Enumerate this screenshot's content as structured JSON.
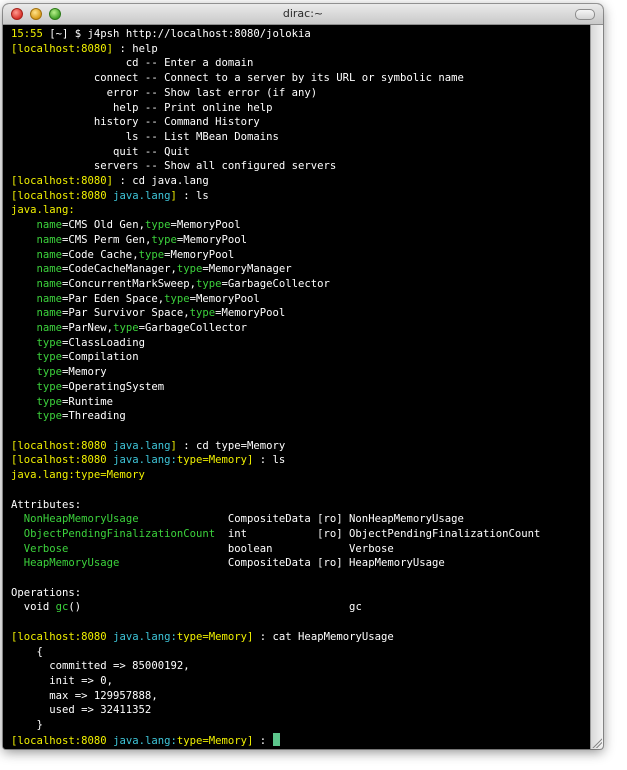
{
  "window": {
    "title": "dirac:~"
  },
  "prompt": {
    "host": "[localhost:8080]",
    "ctx_lang": "java.lang",
    "ctx_lang_pre": "java.lang:",
    "ctx_mem": "type=Memory",
    "sep": " : ",
    "close": "]"
  },
  "first_line": {
    "time": "15:55",
    "bracket": " [~] $ ",
    "command": "j4psh http://localhost:8080/jolokia"
  },
  "help": {
    "command": "help",
    "items": [
      {
        "name": "cd",
        "desc": "Enter a domain"
      },
      {
        "name": "connect",
        "desc": "Connect to a server by its URL or symbolic name"
      },
      {
        "name": "error",
        "desc": "Show last error (if any)"
      },
      {
        "name": "help",
        "desc": "Print online help"
      },
      {
        "name": "history",
        "desc": "Command History"
      },
      {
        "name": "ls",
        "desc": "List MBean Domains"
      },
      {
        "name": "quit",
        "desc": "Quit"
      },
      {
        "name": "servers",
        "desc": "Show all configured servers"
      }
    ]
  },
  "cmd_cd_java_lang": "cd java.lang",
  "cmd_ls": "ls",
  "domain_header": "java.lang:",
  "mbeans": [
    {
      "name": "CMS Old Gen",
      "type": "MemoryPool"
    },
    {
      "name": "CMS Perm Gen",
      "type": "MemoryPool"
    },
    {
      "name": "Code Cache",
      "type": "MemoryPool"
    },
    {
      "name": "CodeCacheManager",
      "type": "MemoryManager"
    },
    {
      "name": "ConcurrentMarkSweep",
      "type": "GarbageCollector"
    },
    {
      "name": "Par Eden Space",
      "type": "MemoryPool"
    },
    {
      "name": "Par Survivor Space",
      "type": "MemoryPool"
    },
    {
      "name": "ParNew",
      "type": "GarbageCollector"
    },
    {
      "name": "",
      "type": "ClassLoading"
    },
    {
      "name": "",
      "type": "Compilation"
    },
    {
      "name": "",
      "type": "Memory"
    },
    {
      "name": "",
      "type": "OperatingSystem"
    },
    {
      "name": "",
      "type": "Runtime"
    },
    {
      "name": "",
      "type": "Threading"
    }
  ],
  "keys": {
    "name": "name",
    "type": "type",
    "eq": "=",
    "comma": ","
  },
  "cmd_cd_memory": "cd type=Memory",
  "mbean_header": "java.lang:type=Memory",
  "attributes": {
    "label": "Attributes:",
    "rows": [
      {
        "name": "NonHeapMemoryUsage",
        "type": "CompositeData",
        "ro": "[ro]",
        "desc": "NonHeapMemoryUsage"
      },
      {
        "name": "ObjectPendingFinalizationCount",
        "type": "int",
        "ro": "[ro]",
        "desc": "ObjectPendingFinalizationCount"
      },
      {
        "name": "Verbose",
        "type": "boolean",
        "ro": "",
        "desc": "Verbose"
      },
      {
        "name": "HeapMemoryUsage",
        "type": "CompositeData",
        "ro": "[ro]",
        "desc": "HeapMemoryUsage"
      }
    ]
  },
  "operations": {
    "label": "Operations:",
    "rows": [
      {
        "ret": "void",
        "name": "gc",
        "args": "()",
        "desc": "gc"
      }
    ]
  },
  "cmd_cat": "cat HeapMemoryUsage",
  "cat_output": {
    "open": "{",
    "lines": [
      "committed => 85000192,",
      "init => 0,",
      "max => 129957888,",
      "used => 32411352"
    ],
    "close": "}"
  }
}
